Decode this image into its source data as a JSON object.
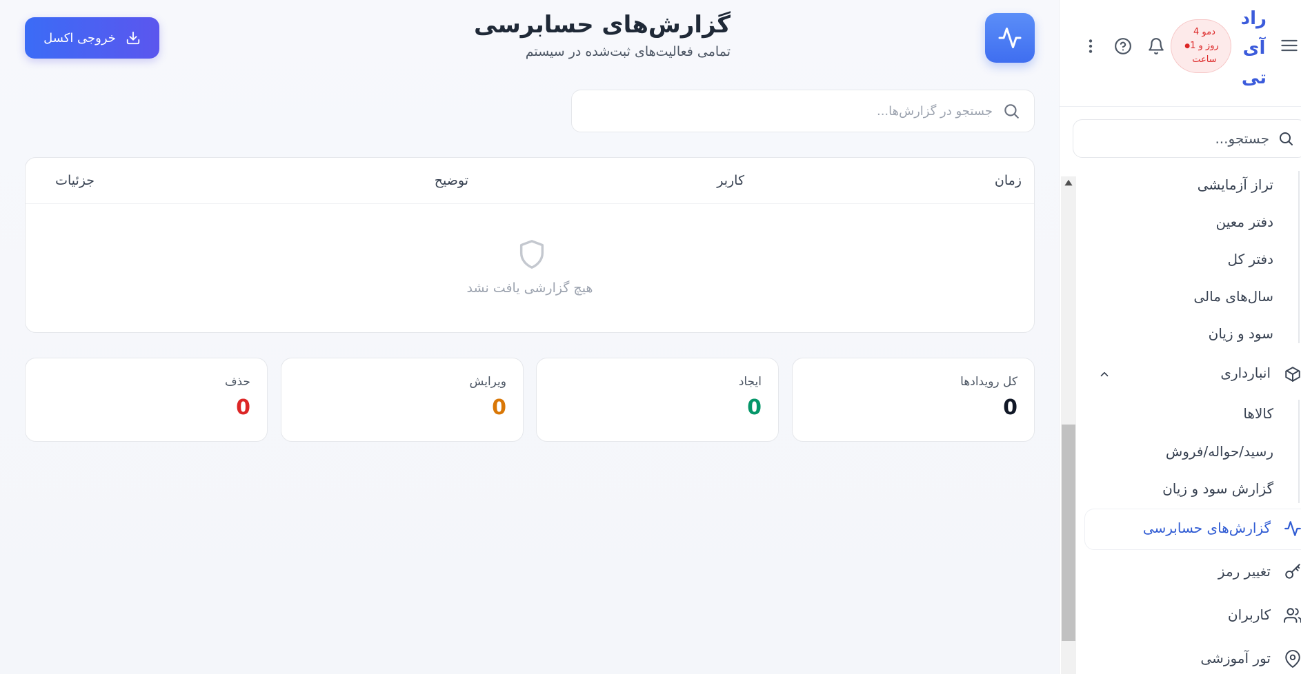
{
  "header": {
    "title": "گزارش‌های حسابرسی",
    "subtitle": "تمامی فعالیت‌های ثبت‌شده در سیستم",
    "export_label": "خروجی اکسل"
  },
  "search": {
    "placeholder": "جستجو در گزارش‌ها..."
  },
  "table": {
    "columns": [
      "زمان",
      "کاربر",
      "توضیح",
      "جزئیات"
    ],
    "empty_text": "هیچ گزارشی یافت نشد"
  },
  "stats": [
    {
      "label": "کل رویدادها",
      "value": "0",
      "color": "#111827"
    },
    {
      "label": "ایجاد",
      "value": "0",
      "color": "#059669"
    },
    {
      "label": "ویرایش",
      "value": "0",
      "color": "#d97706"
    },
    {
      "label": "حذف",
      "value": "0",
      "color": "#dc2626"
    }
  ],
  "sidebar": {
    "brand_lines": [
      "راد",
      "آی",
      "تی"
    ],
    "demo_lines": [
      "دمو 4",
      "روز و 1",
      "ساعت"
    ],
    "search_placeholder": "جستجو...",
    "items": [
      {
        "label": "تراز آزمایشی",
        "icon": ""
      },
      {
        "label": "دفتر معین",
        "icon": ""
      },
      {
        "label": "دفتر کل",
        "icon": ""
      },
      {
        "label": "سال‌های مالی",
        "icon": ""
      },
      {
        "label": "سود و زیان",
        "icon": ""
      },
      {
        "label": "انبارداری",
        "icon": "box-icon"
      },
      {
        "label": "کالاها",
        "icon": ""
      },
      {
        "label": "رسید/حواله/فروش",
        "icon": ""
      },
      {
        "label": "گزارش سود و زیان",
        "icon": ""
      },
      {
        "label": "گزارش‌های حسابرسی",
        "icon": "activity-icon"
      },
      {
        "label": "تغییر رمز",
        "icon": "key-icon"
      },
      {
        "label": "کاربران",
        "icon": "users-icon"
      },
      {
        "label": "تور آموزشی",
        "icon": "map-pin-icon"
      }
    ]
  },
  "colors": {
    "accent": "#3b6cf6",
    "active_nav": "#2f5bd3",
    "brand": "#3b5bdb"
  }
}
